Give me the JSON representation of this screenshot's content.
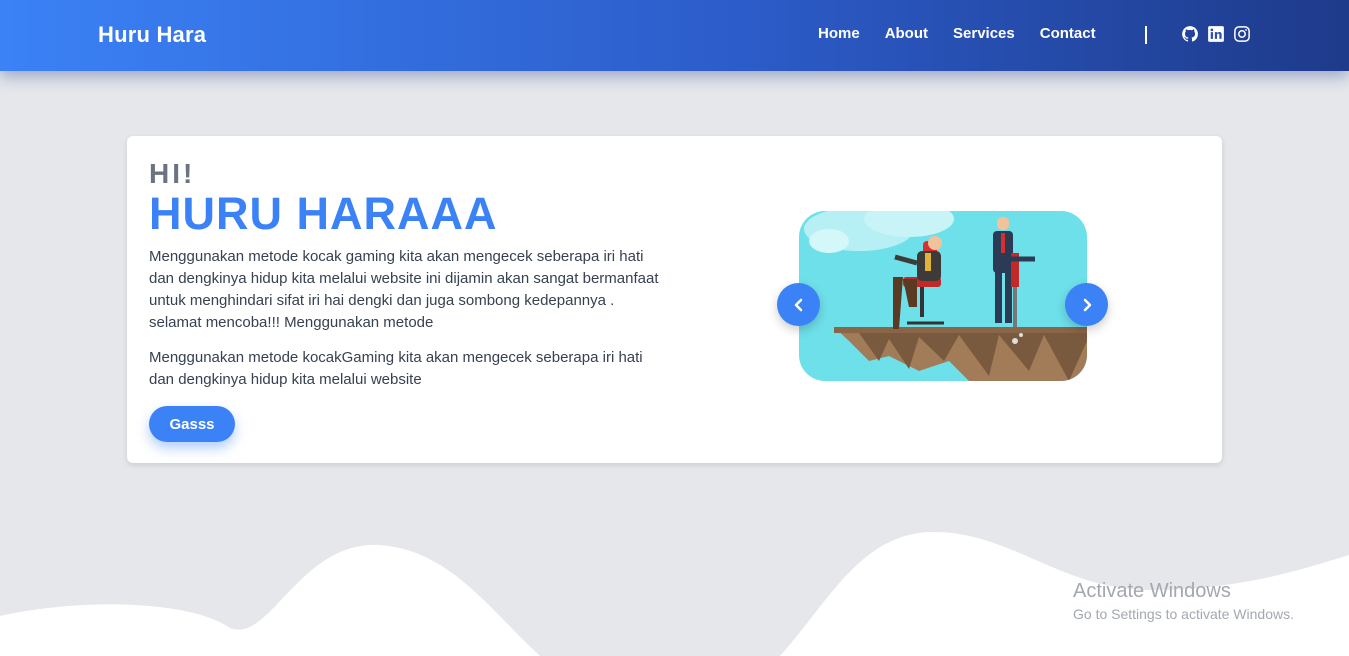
{
  "navbar": {
    "brand": "Huru Hara",
    "links": [
      "Home",
      "About",
      "Services",
      "Contact"
    ],
    "social_icons": [
      "github-icon",
      "linkedin-icon",
      "instagram-icon"
    ]
  },
  "hero": {
    "greeting": "HI!",
    "title": "HURU HARAAA",
    "paragraph_1": "Menggunakan metode kocak gaming kita akan mengecek seberapa iri hati dan dengkinya hidup kita melalui website ini dijamin akan sangat bermanfaat untuk menghindari sifat iri hai dengki dan juga sombong kedepannya . selamat mencoba!!! Menggunakan metode",
    "paragraph_2": "Menggunakan metode kocakGaming kita akan mengecek seberapa iri hati dan dengkinya hidup kita melalui website",
    "button_label": "Gasss"
  },
  "carousel": {
    "prev_icon": "chevron-left-icon",
    "next_icon": "chevron-right-icon"
  },
  "watermark": {
    "title": "Activate Windows",
    "subtitle": "Go to Settings to activate Windows."
  },
  "colors": {
    "accent": "#3b82f6",
    "nav_dark": "#1e3a8a",
    "background": "#e5e7eb"
  }
}
